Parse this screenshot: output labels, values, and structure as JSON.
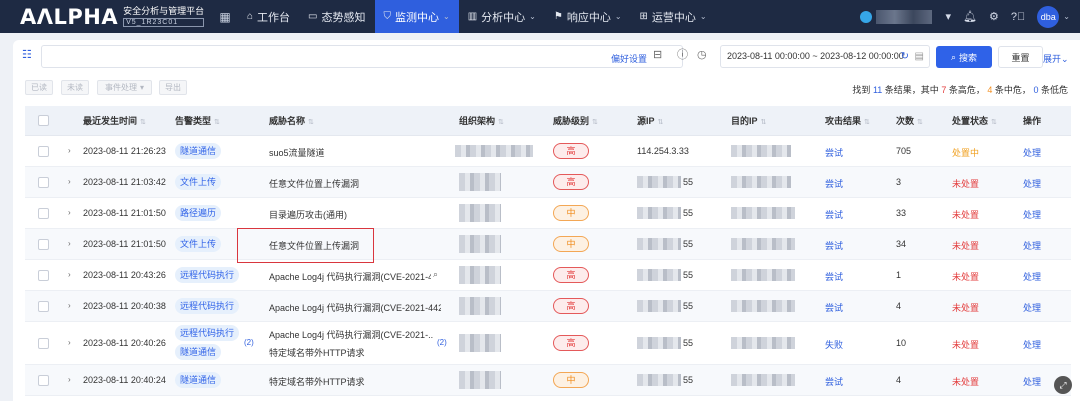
{
  "topbar": {
    "logo": "AɅLPHA",
    "subtitle": "安全分析与管理平台",
    "version": "V5_1R23C01",
    "nav": [
      {
        "label": "工作台",
        "icon": "home-icon"
      },
      {
        "label": "态势感知",
        "icon": "monitor-icon"
      },
      {
        "label": "监测中心",
        "icon": "shield-icon",
        "active": true,
        "chevron": true
      },
      {
        "label": "分析中心",
        "icon": "chart-icon",
        "chevron": true
      },
      {
        "label": "响应中心",
        "icon": "response-icon",
        "chevron": true
      },
      {
        "label": "运营中心",
        "icon": "operation-icon",
        "chevron": true
      }
    ],
    "user": "dba"
  },
  "search": {
    "pref_label": "偏好设置",
    "date_range": "2023-08-11 00:00:00 ~ 2023-08-12 00:00:00",
    "search_label": "搜索",
    "reset_label": "重置",
    "expand_label": "展开"
  },
  "actions": {
    "buttons": [
      "已读",
      "未读",
      "事件处理",
      "导出"
    ],
    "summary_prefix": "找到",
    "total": "11",
    "summary_mid1": "条结果，其中",
    "high": "7",
    "summary_mid2": "条高危，",
    "mid": "4",
    "summary_mid3": "条中危，",
    "low": "0",
    "summary_suffix": "条低危"
  },
  "table": {
    "headers": [
      "最近发生时间",
      "告警类型",
      "威胁名称",
      "组织架构",
      "威胁级别",
      "源IP",
      "目的IP",
      "攻击结果",
      "次数",
      "处置状态",
      "操作"
    ],
    "rows": [
      {
        "time": "2023-08-11 21:26:23",
        "types": [
          "隧道通信"
        ],
        "name": "suo5流量隧道",
        "level": "高",
        "src": "114.254.3.33",
        "dst": "",
        "result": "尝试",
        "count": "705",
        "status": "处置中",
        "op": "处理"
      },
      {
        "time": "2023-08-11 21:03:42",
        "types": [
          "文件上传"
        ],
        "name": "任意文件位置上传漏洞",
        "level": "高",
        "src": "55",
        "dst": "",
        "result": "尝试",
        "count": "3",
        "status": "未处置",
        "op": "处理"
      },
      {
        "time": "2023-08-11 21:01:50",
        "types": [
          "路径遍历"
        ],
        "name": "目录遍历攻击(通用)",
        "level": "中",
        "src": "55",
        "dst": "",
        "result": "尝试",
        "count": "33",
        "status": "未处置",
        "op": "处理"
      },
      {
        "time": "2023-08-11 21:01:50",
        "types": [
          "文件上传"
        ],
        "name": "任意文件位置上传漏洞",
        "level": "中",
        "src": "55",
        "dst": "",
        "result": "尝试",
        "count": "34",
        "status": "未处置",
        "op": "处理"
      },
      {
        "time": "2023-08-11 20:43:26",
        "types": [
          "远程代码执行"
        ],
        "name": "Apache Log4j 代码执行漏洞(CVE-2021-4",
        "level": "高",
        "src": "55",
        "dst": "",
        "result": "尝试",
        "count": "1",
        "status": "未处置",
        "op": "处理"
      },
      {
        "time": "2023-08-11 20:40:38",
        "types": [
          "远程代码执行"
        ],
        "name": "Apache Log4j 代码执行漏洞(CVE-2021-4422",
        "level": "高",
        "src": "55",
        "dst": "",
        "result": "尝试",
        "count": "4",
        "status": "未处置",
        "op": "处理"
      },
      {
        "time": "2023-08-11 20:40:26",
        "types": [
          "远程代码执行",
          "隧道通信"
        ],
        "type_more": "(2)",
        "name": "Apache Log4j 代码执行漏洞(CVE-2021-...",
        "name2": "特定域名带外HTTP请求",
        "name_more": "(2)",
        "level": "高",
        "src": "55",
        "dst": "",
        "result": "失败",
        "count": "10",
        "status": "未处置",
        "op": "处理"
      },
      {
        "time": "2023-08-11 20:40:24",
        "types": [
          "隧道通信"
        ],
        "name": "特定域名带外HTTP请求",
        "level": "中",
        "src": "55",
        "dst": "",
        "result": "尝试",
        "count": "4",
        "status": "未处置",
        "op": "处理"
      }
    ]
  }
}
